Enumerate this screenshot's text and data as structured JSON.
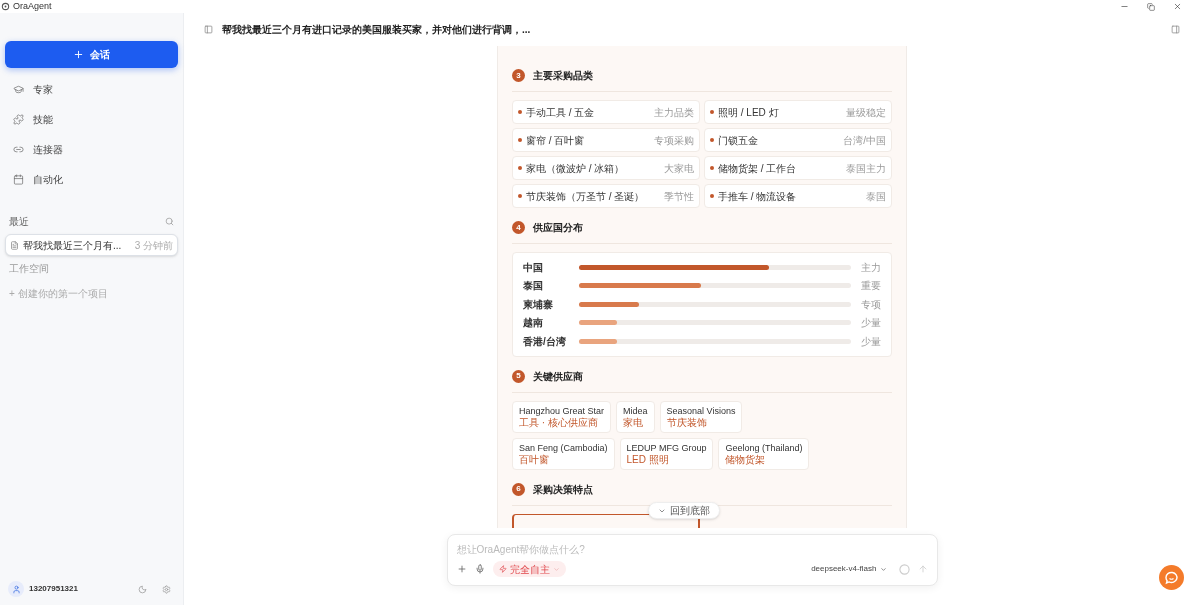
{
  "window": {
    "title": "OraAgent"
  },
  "sidebar": {
    "new_chat_button": "会话",
    "nav_items": [
      {
        "kind": "experts",
        "label": "专家"
      },
      {
        "kind": "skills",
        "label": "技能"
      },
      {
        "kind": "connectors",
        "label": "连接器"
      },
      {
        "kind": "automation",
        "label": "自动化"
      }
    ],
    "recent_label": "最近",
    "recent_items": [
      {
        "title": "帮我找最近三个月有...",
        "time": "3 分钟前",
        "selected": true
      }
    ],
    "workspace_label": "工作空间",
    "create_project_link": "+ 创建你的第一个项目",
    "user": {
      "name": "13207951321"
    }
  },
  "conversation": {
    "title": "帮我找最近三个月有进口记录的美国服装买家，并对他们进行背调，..."
  },
  "report": {
    "sections": [
      {
        "number": "3",
        "title": "主要采购品类",
        "kind": "categories",
        "items": [
          {
            "label": "手动工具 / 五金",
            "tag": "主力品类"
          },
          {
            "label": "照明 / LED 灯",
            "tag": "量级稳定"
          },
          {
            "label": "窗帘 / 百叶窗",
            "tag": "专项采购"
          },
          {
            "label": "门锁五金",
            "tag": "台湾/中国"
          },
          {
            "label": "家电（微波炉 / 冰箱）",
            "tag": "大家电"
          },
          {
            "label": "储物货架 / 工作台",
            "tag": "泰国主力"
          },
          {
            "label": "节庆装饰（万圣节 / 圣诞）",
            "tag": "季节性"
          },
          {
            "label": "手推车 / 物流设备",
            "tag": "泰国"
          }
        ]
      },
      {
        "number": "4",
        "title": "供应国分布",
        "kind": "bars",
        "rows": [
          {
            "label": "中国",
            "level": 0.7,
            "reading": "主力",
            "color": "#c2572b"
          },
          {
            "label": "泰国",
            "level": 0.45,
            "reading": "重要",
            "color": "#d87a4c"
          },
          {
            "label": "柬埔寨",
            "level": 0.22,
            "reading": "专项",
            "color": "#d87a4c"
          },
          {
            "label": "越南",
            "level": 0.14,
            "reading": "少量",
            "color": "#e9a47e"
          },
          {
            "label": "香港/台湾",
            "level": 0.14,
            "reading": "少量",
            "color": "#e9a47e"
          }
        ]
      },
      {
        "number": "5",
        "title": "关键供应商",
        "kind": "suppliers",
        "items": [
          {
            "name": "Hangzhou Great Star",
            "note": "工具 · 核心供应商"
          },
          {
            "name": "Midea",
            "note": "家电"
          },
          {
            "name": "Seasonal Visions",
            "note": "节庆装饰"
          },
          {
            "name": "San Feng (Cambodia)",
            "note": "百叶窗"
          },
          {
            "name": "LEDUP MFG Group",
            "note": "LED 照明"
          },
          {
            "name": "Geelong (Thailand)",
            "note": "储物货架"
          }
        ]
      },
      {
        "number": "6",
        "title": "采购决策特点",
        "kind": "cut_cards"
      }
    ],
    "scroll_button": "回到底部"
  },
  "composer": {
    "placeholder": "想让OraAgent帮你做点什么?",
    "mode": "完全自主",
    "model": "deepseek-v4-flash"
  }
}
